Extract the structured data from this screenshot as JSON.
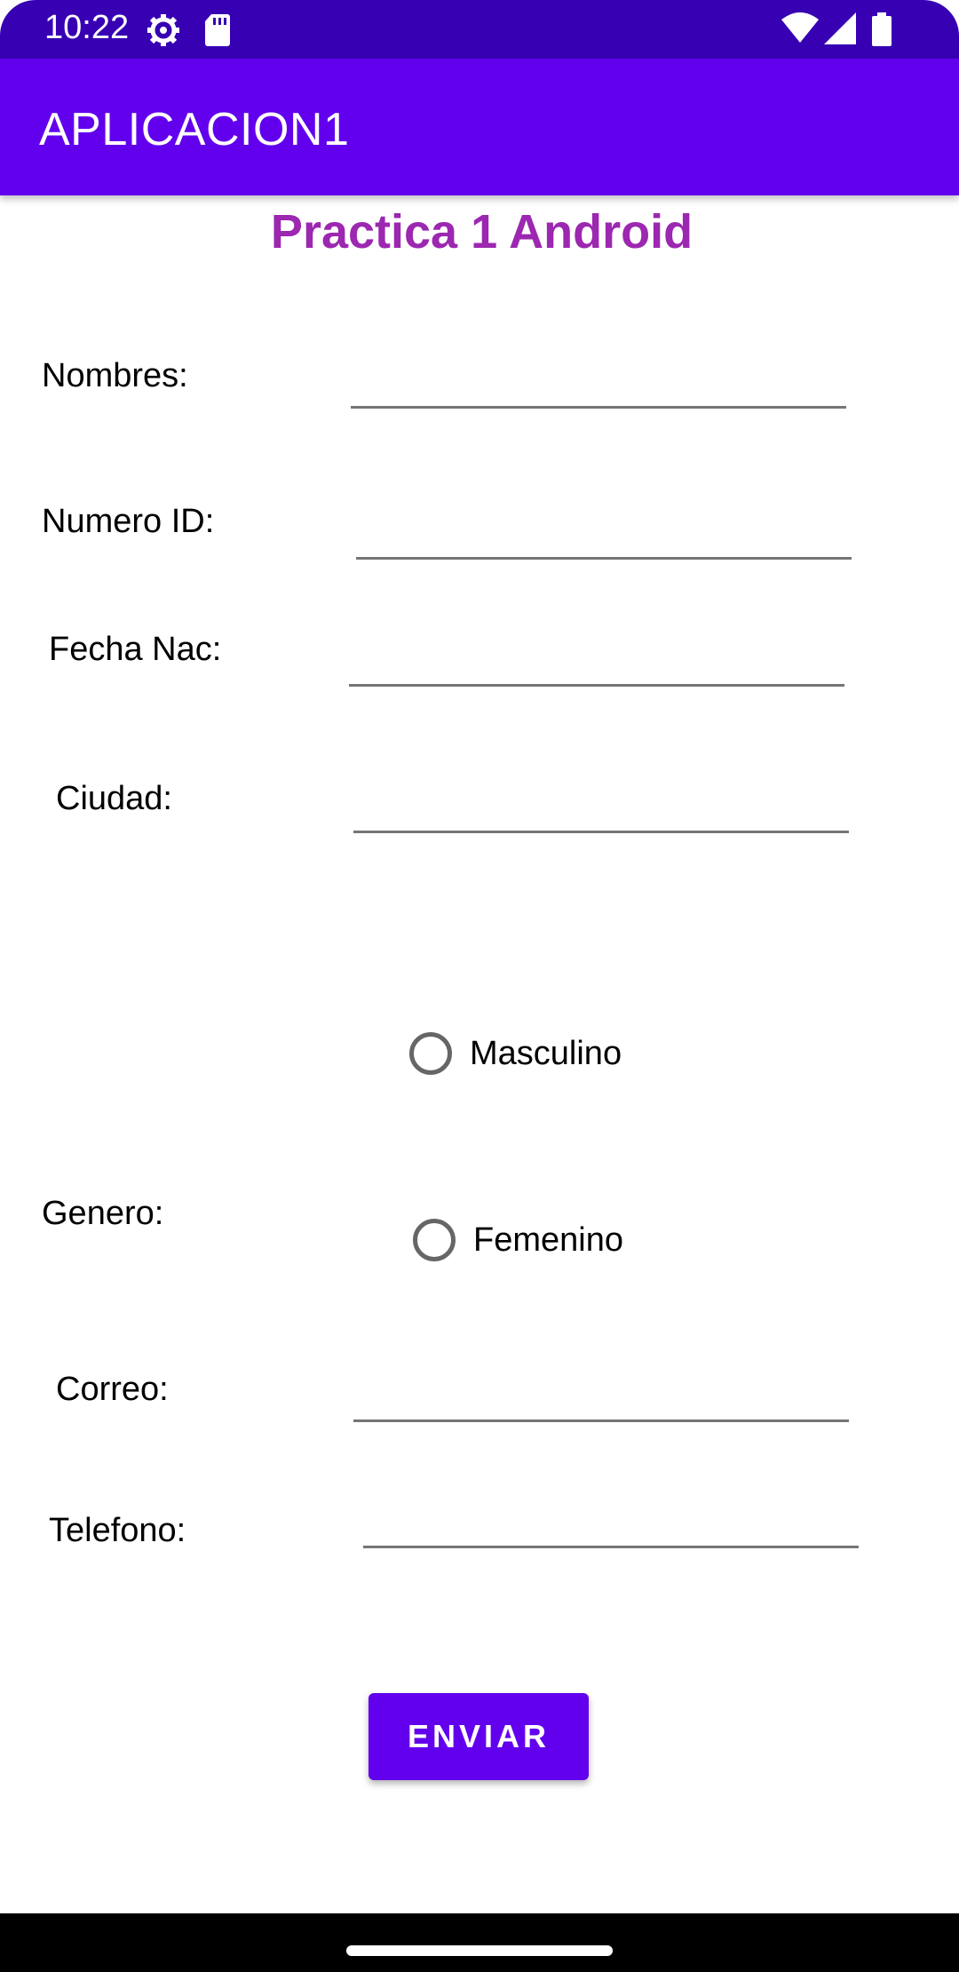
{
  "status_bar": {
    "time": "10:22",
    "icons": [
      "settings-gear-icon",
      "sd-card-icon",
      "wifi-icon",
      "signal-icon",
      "battery-icon"
    ]
  },
  "app_bar": {
    "title": "APLICACION1",
    "color": "#6200ee"
  },
  "page_title": {
    "text": "Practica 1 Android",
    "color": "#9c27b0"
  },
  "form": {
    "nombres_label": "Nombres:",
    "nombres_value": "",
    "numero_id_label": "Numero ID:",
    "numero_id_value": "",
    "fecha_nac_label": "Fecha Nac:",
    "fecha_nac_value": "",
    "ciudad_label": "Ciudad:",
    "ciudad_value": "",
    "genero_label": "Genero:",
    "genero_options": [
      {
        "label": "Masculino",
        "selected": false
      },
      {
        "label": "Femenino",
        "selected": false
      }
    ],
    "correo_label": "Correo:",
    "correo_value": "",
    "telefono_label": "Telefono:",
    "telefono_value": ""
  },
  "send_button": {
    "label": "ENVIAR"
  }
}
